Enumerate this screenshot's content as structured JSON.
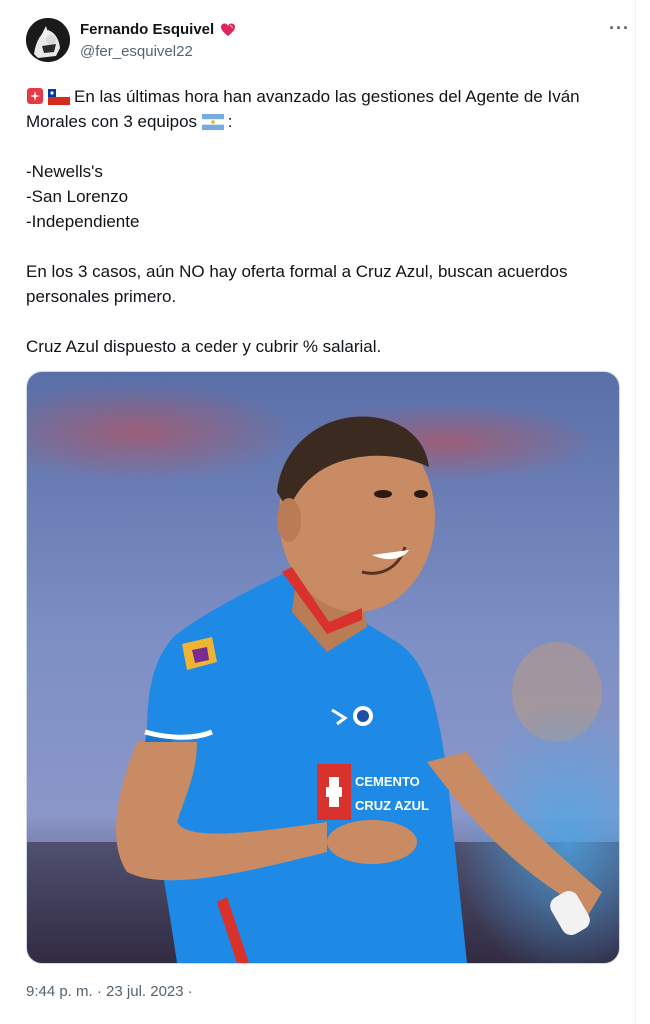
{
  "author": {
    "name": "Fernando Esquivel",
    "handle": "@fer_esquivel22",
    "badge_icon": "heart-icon"
  },
  "menu": {
    "more_label": "···"
  },
  "tweet": {
    "line1": "En las últimas hora han avanzado las gestiones del Agente de Iván Morales con 3 equipos",
    "line1_suffix": ":",
    "teams": [
      "-Newells's",
      "-San Lorenzo",
      "-Independiente"
    ],
    "para2": "En los 3 casos, aún NO hay oferta formal a Cruz Azul, buscan acuerdos personales primero.",
    "para3": "Cruz Azul dispuesto a ceder y cubrir % salarial."
  },
  "media": {
    "description_icon": "player-photo",
    "sponsor_text_1": "CEMENTO",
    "sponsor_text_2": "CRUZ AZUL"
  },
  "meta": {
    "time": "9:44 p. m.",
    "separator": "·",
    "date": "23 jul. 2023",
    "trailing_dot": "·"
  },
  "colors": {
    "text": "#0f1419",
    "secondary": "#536471",
    "jersey": "#1e8ae6",
    "heart": "#e0245e"
  }
}
